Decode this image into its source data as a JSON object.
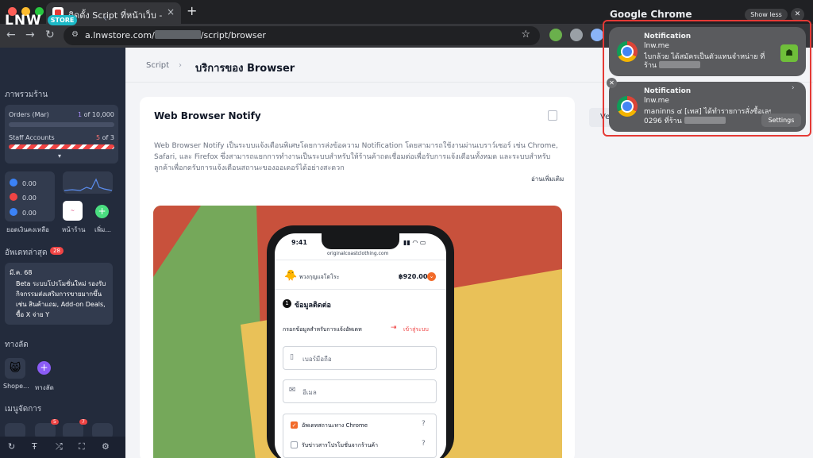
{
  "browser": {
    "tab_title": "ติดตั้ง Script ที่หน้าเว็บ - LnwSt",
    "url_prefix": "a.lnwstore.com/",
    "url_suffix": "/script/browser",
    "new_tab": "+",
    "tab_close": "×"
  },
  "sidebar": {
    "logo": "LNW",
    "logo_badge": "STORE",
    "overview_title": "ภาพรวมร้าน",
    "orders_label": "Orders (Mar)",
    "orders_used": "1",
    "orders_of": "of 10,000",
    "staff_label": "Staff Accounts",
    "staff_used": "5",
    "staff_of": "of 3",
    "balances": [
      "0.00",
      "0.00",
      "0.00"
    ],
    "balance_caption": "ยอดเงินคงเหลือ",
    "shop_caption": "หน้าร้าน",
    "more_caption": "เพิ่ม...",
    "updates_title": "อัพเดทล่าสุด",
    "updates_count": "28",
    "update_date": "มี.ค. 68",
    "update_text": "Beta ระบบโปรโมชั่นใหม่ รองรับกิจกรรมส่งเสริมการขายมากขึ้น เช่น สินค้าแถม, Add-on Deals, ซื้อ X จ่าย Y",
    "shortcuts_title": "ทางลัด",
    "shortcut_1": "Shope...",
    "shortcut_2": "ทางลัด",
    "menu_title": "เมนูจัดการ",
    "menu_badge_1": "5",
    "menu_badge_2": "7"
  },
  "main": {
    "breadcrumb": "Script",
    "page_title": "บริการของ Browser",
    "side_button": "Ve",
    "panel_title": "Web Browser Notify",
    "description": "Web Browser Notify เป็นระบบแจ้งเตือนพิเศษโดยการส่งข้อความ Notification โดยสามารถใช้งานผ่านเบราว์เซอร์ เช่น Chrome, Safari, และ Firefox ซึ่งสามารถแยกการทำงานเป็นระบบสำหรับให้ร้านค้าถดเชื่อมต่อเพื่อรับการแจ้งเตือนทั้งหมด และระบบสำหรับลูกค้าเพื่อกดรับการแจ้งเตือนสถานะของออเดอร์ได้อย่างสะดวก",
    "read_more": "อ่านเพิ่มเติม"
  },
  "phone": {
    "time": "9:41",
    "domain": "originalcoastclothing.com",
    "cart_name": "พวงกุญแจโตโระ",
    "cart_total": "฿920.00",
    "step_title": "ข้อมูลติดต่อ",
    "receive_label": "กรอกข้อมูลสำหรับการแจ้งอัพเดท",
    "login_link": "เข้าสู่ระบบ",
    "phone_placeholder": "เบอร์มือถือ",
    "email_placeholder": "อีเมล",
    "option_1": "อัพเดทสถานะทาง Chrome",
    "option_2": "รับข่าวสารโปรโมชั่นจากร้านค้า"
  },
  "notifications": {
    "app_name": "Google Chrome",
    "show_less": "Show less",
    "items": [
      {
        "title": "Notification",
        "source": "lnw.me",
        "body_1": "ไบกล้วย ได้สมัครเป็นตัวแทนจำหน่าย ที่",
        "body_2": "ร้าน"
      },
      {
        "title": "Notification",
        "source": "lnw.me",
        "body_1": "maninns ๔ [เทส] ได้ทำรายการสั่งซื้อเลขที่",
        "body_2": "0296 ที่ร้าน",
        "action": "Settings"
      }
    ]
  },
  "colors": {
    "accent_red": "#e53935",
    "sidebar_bg": "#232b3c",
    "hero_red": "#c8513c",
    "hero_green": "#75a85a",
    "hero_yellow": "#e9c158",
    "orange": "#f26b2a"
  }
}
